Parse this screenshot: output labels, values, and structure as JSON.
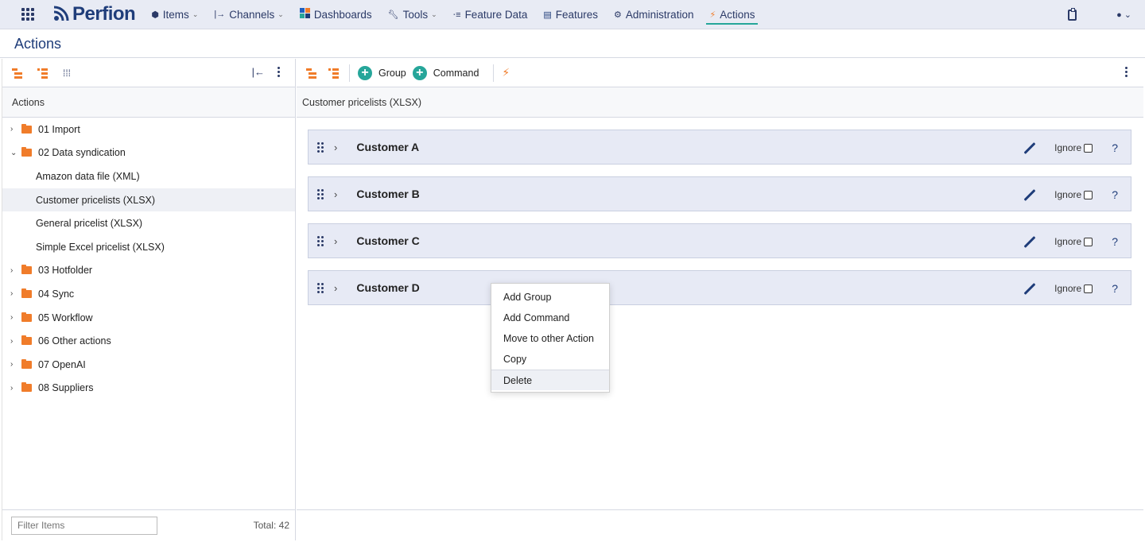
{
  "app": {
    "logo_text": "Perfion"
  },
  "nav": [
    {
      "label": "Items",
      "icon": "items-icon",
      "dropdown": true
    },
    {
      "label": "Channels",
      "icon": "channels-icon",
      "dropdown": true
    },
    {
      "label": "Dashboards",
      "icon": "dashboards-icon",
      "dropdown": false
    },
    {
      "label": "Tools",
      "icon": "wrench-icon",
      "dropdown": true
    },
    {
      "label": "Feature Data",
      "icon": "feature-data-icon",
      "dropdown": false
    },
    {
      "label": "Features",
      "icon": "database-icon",
      "dropdown": false
    },
    {
      "label": "Administration",
      "icon": "gear-icon",
      "dropdown": false
    },
    {
      "label": "Actions",
      "icon": "actions-icon",
      "dropdown": false,
      "active": true
    }
  ],
  "page": {
    "title": "Actions"
  },
  "left": {
    "header": "Actions",
    "tree": [
      {
        "label": "01 Import",
        "expanded": false
      },
      {
        "label": "02 Data syndication",
        "expanded": true,
        "children": [
          {
            "label": "Amazon data file (XML)"
          },
          {
            "label": "Customer pricelists (XLSX)",
            "selected": true
          },
          {
            "label": "General pricelist (XLSX)"
          },
          {
            "label": "Simple Excel pricelist (XLSX)"
          }
        ]
      },
      {
        "label": "03 Hotfolder",
        "expanded": false
      },
      {
        "label": "04 Sync",
        "expanded": false
      },
      {
        "label": "05 Workflow",
        "expanded": false
      },
      {
        "label": "06 Other actions",
        "expanded": false
      },
      {
        "label": "07 OpenAI",
        "expanded": false
      },
      {
        "label": "08 Suppliers",
        "expanded": false
      }
    ],
    "filter_placeholder": "Filter Items",
    "total": "Total: 42"
  },
  "right": {
    "toolbar": {
      "group_label": "Group",
      "command_label": "Command"
    },
    "header": "Customer pricelists (XLSX)",
    "groups": [
      {
        "name": "Customer A",
        "ignore_label": "Ignore",
        "help": "?"
      },
      {
        "name": "Customer B",
        "ignore_label": "Ignore",
        "help": "?"
      },
      {
        "name": "Customer C",
        "ignore_label": "Ignore",
        "help": "?"
      },
      {
        "name": "Customer D",
        "ignore_label": "Ignore",
        "help": "?"
      }
    ]
  },
  "context_menu": [
    "Add Group",
    "Add Command",
    "Move to other Action",
    "Copy",
    "Delete"
  ],
  "colors": {
    "accent": "#26a69a",
    "brand": "#1f3d7a",
    "folder": "#f07c2a",
    "topbar": "#e8ebf4"
  }
}
